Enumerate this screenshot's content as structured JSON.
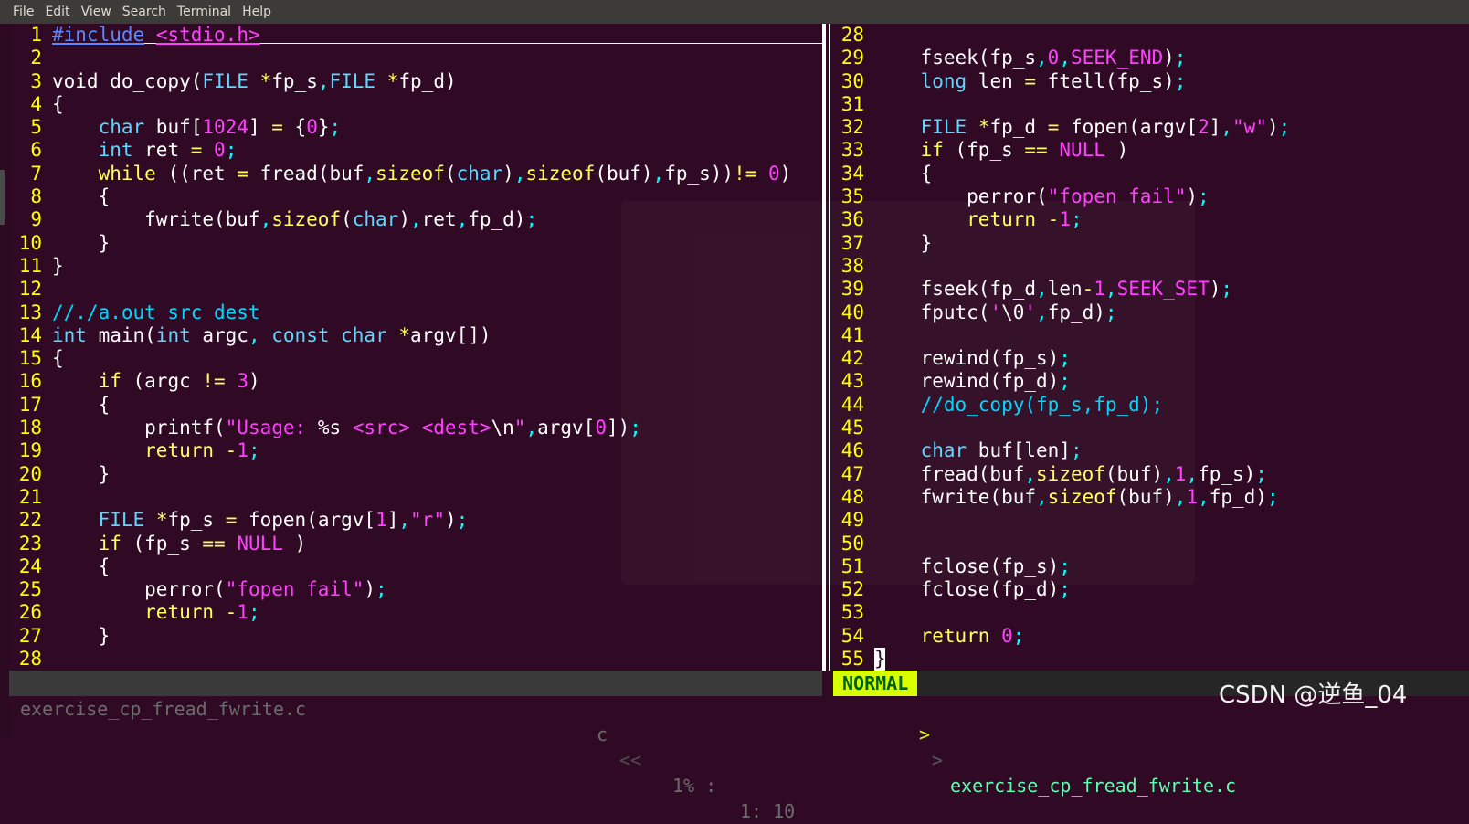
{
  "menubar": {
    "items": [
      "File",
      "Edit",
      "View",
      "Search",
      "Terminal",
      "Help"
    ]
  },
  "left_pane": {
    "lines": [
      {
        "n": "1",
        "html": "<span class=\"t-pp u\">#include</span> <span class=\"t-str u\">&lt;stdio.h&gt;</span>"
      },
      {
        "n": "2",
        "html": ""
      },
      {
        "n": "3",
        "html": "void do_copy(<span class=\"t-type\">FILE</span> <span class=\"t-op\">*</span>fp_s<span class=\"t-punc\">,</span><span class=\"t-type\">FILE</span> <span class=\"t-op\">*</span>fp_d)"
      },
      {
        "n": "4",
        "html": "{"
      },
      {
        "n": "5",
        "html": "    <span class=\"t-type\">char</span> buf[<span class=\"t-num\">1024</span>] <span class=\"t-op\">=</span> {<span class=\"t-num\">0</span>}<span class=\"t-punc\">;</span>"
      },
      {
        "n": "6",
        "html": "    <span class=\"t-type\">int</span> ret <span class=\"t-op\">=</span> <span class=\"t-num\">0</span><span class=\"t-punc\">;</span>"
      },
      {
        "n": "7",
        "html": "    <span class=\"t-kw\">while</span> ((ret <span class=\"t-op\">=</span> fread(buf<span class=\"t-punc\">,</span><span class=\"t-kw\">sizeof</span>(<span class=\"t-type\">char</span>)<span class=\"t-punc\">,</span><span class=\"t-kw\">sizeof</span>(buf)<span class=\"t-punc\">,</span>fp_s))<span class=\"t-op\">!=</span> <span class=\"t-num\">0</span>)"
      },
      {
        "n": "8",
        "html": "    {"
      },
      {
        "n": "9",
        "html": "        fwrite(buf<span class=\"t-punc\">,</span><span class=\"t-kw\">sizeof</span>(<span class=\"t-type\">char</span>)<span class=\"t-punc\">,</span>ret<span class=\"t-punc\">,</span>fp_d)<span class=\"t-punc\">;</span>"
      },
      {
        "n": "10",
        "html": "    }"
      },
      {
        "n": "11",
        "html": "}"
      },
      {
        "n": "12",
        "html": ""
      },
      {
        "n": "13",
        "html": "<span class=\"t-cmt\">//./a.out src dest</span>"
      },
      {
        "n": "14",
        "html": "<span class=\"t-type\">int</span> main(<span class=\"t-type\">int</span> argc<span class=\"t-punc\">,</span> <span class=\"t-type\">const</span> <span class=\"t-type\">char</span> <span class=\"t-op\">*</span>argv[])"
      },
      {
        "n": "15",
        "html": "{"
      },
      {
        "n": "16",
        "html": "    <span class=\"t-kw\">if</span> (argc <span class=\"t-op\">!=</span> <span class=\"t-num\">3</span>)"
      },
      {
        "n": "17",
        "html": "    {"
      },
      {
        "n": "18",
        "html": "        printf(<span class=\"t-str\">\"Usage: </span>%s<span class=\"t-str\"> &lt;src&gt; &lt;dest&gt;</span>\\n<span class=\"t-str\">\"</span><span class=\"t-punc\">,</span>argv[<span class=\"t-num\">0</span>])<span class=\"t-punc\">;</span>"
      },
      {
        "n": "19",
        "html": "        <span class=\"t-kw\">return</span> <span class=\"t-op\">-</span><span class=\"t-num\">1</span><span class=\"t-punc\">;</span>"
      },
      {
        "n": "20",
        "html": "    }"
      },
      {
        "n": "21",
        "html": ""
      },
      {
        "n": "22",
        "html": "    <span class=\"t-type\">FILE</span> <span class=\"t-op\">*</span>fp_s <span class=\"t-op\">=</span> fopen(argv[<span class=\"t-num\">1</span>]<span class=\"t-punc\">,</span><span class=\"t-str\">\"r\"</span>)<span class=\"t-punc\">;</span>"
      },
      {
        "n": "23",
        "html": "    <span class=\"t-kw\">if</span> (fp_s <span class=\"t-op\">==</span> <span class=\"t-spec\">NULL</span> )"
      },
      {
        "n": "24",
        "html": "    {"
      },
      {
        "n": "25",
        "html": "        perror(<span class=\"t-str\">\"fopen fail\"</span>)<span class=\"t-punc\">;</span>"
      },
      {
        "n": "26",
        "html": "        <span class=\"t-kw\">return</span> <span class=\"t-op\">-</span><span class=\"t-num\">1</span><span class=\"t-punc\">;</span>"
      },
      {
        "n": "27",
        "html": "    }"
      },
      {
        "n": "28",
        "html": ""
      }
    ]
  },
  "right_pane": {
    "lines": [
      {
        "n": "28",
        "html": ""
      },
      {
        "n": "29",
        "html": "    fseek(fp_s<span class=\"t-punc\">,</span><span class=\"t-num\">0</span><span class=\"t-punc\">,</span><span class=\"t-spec\">SEEK_END</span>)<span class=\"t-punc\">;</span>"
      },
      {
        "n": "30",
        "html": "    <span class=\"t-type\">long</span> len <span class=\"t-op\">=</span> ftell(fp_s)<span class=\"t-punc\">;</span>"
      },
      {
        "n": "31",
        "html": ""
      },
      {
        "n": "32",
        "html": "    <span class=\"t-type\">FILE</span> <span class=\"t-op\">*</span>fp_d <span class=\"t-op\">=</span> fopen(argv[<span class=\"t-num\">2</span>]<span class=\"t-punc\">,</span><span class=\"t-str\">\"w\"</span>)<span class=\"t-punc\">;</span>"
      },
      {
        "n": "33",
        "html": "    <span class=\"t-kw\">if</span> (fp_s <span class=\"t-op\">==</span> <span class=\"t-spec\">NULL</span> )"
      },
      {
        "n": "34",
        "html": "    {"
      },
      {
        "n": "35",
        "html": "        perror(<span class=\"t-str\">\"fopen fail\"</span>)<span class=\"t-punc\">;</span>"
      },
      {
        "n": "36",
        "html": "        <span class=\"t-kw\">return</span> <span class=\"t-op\">-</span><span class=\"t-num\">1</span><span class=\"t-punc\">;</span>"
      },
      {
        "n": "37",
        "html": "    }"
      },
      {
        "n": "38",
        "html": ""
      },
      {
        "n": "39",
        "html": "    fseek(fp_d<span class=\"t-punc\">,</span>len<span class=\"t-op\">-</span><span class=\"t-num\">1</span><span class=\"t-punc\">,</span><span class=\"t-spec\">SEEK_SET</span>)<span class=\"t-punc\">;</span>"
      },
      {
        "n": "40",
        "html": "    fputc(<span class=\"t-str\">'</span>\\0<span class=\"t-str\">'</span><span class=\"t-punc\">,</span>fp_d)<span class=\"t-punc\">;</span>"
      },
      {
        "n": "41",
        "html": ""
      },
      {
        "n": "42",
        "html": "    rewind(fp_s)<span class=\"t-punc\">;</span>"
      },
      {
        "n": "43",
        "html": "    rewind(fp_d)<span class=\"t-punc\">;</span>"
      },
      {
        "n": "44",
        "html": "    <span class=\"t-cmt\">//do_copy(fp_s,fp_d);</span>"
      },
      {
        "n": "45",
        "html": ""
      },
      {
        "n": "46",
        "html": "    <span class=\"t-type\">char</span> buf[len]<span class=\"t-punc\">;</span>"
      },
      {
        "n": "47",
        "html": "    fread(buf<span class=\"t-punc\">,</span><span class=\"t-kw\">sizeof</span>(buf)<span class=\"t-punc\">,</span><span class=\"t-num\">1</span><span class=\"t-punc\">,</span>fp_s)<span class=\"t-punc\">;</span>"
      },
      {
        "n": "48",
        "html": "    fwrite(buf<span class=\"t-punc\">,</span><span class=\"t-kw\">sizeof</span>(buf)<span class=\"t-punc\">,</span><span class=\"t-num\">1</span><span class=\"t-punc\">,</span>fp_d)<span class=\"t-punc\">;</span>"
      },
      {
        "n": "49",
        "html": ""
      },
      {
        "n": "50",
        "html": ""
      },
      {
        "n": "51",
        "html": "    fclose(fp_s)<span class=\"t-punc\">;</span>"
      },
      {
        "n": "52",
        "html": "    fclose(fp_d)<span class=\"t-punc\">;</span>"
      },
      {
        "n": "53",
        "html": ""
      },
      {
        "n": "54",
        "html": "    <span class=\"t-kw\">return</span> <span class=\"t-num\">0</span><span class=\"t-punc\">;</span>"
      },
      {
        "n": "55",
        "html": "<span class=\"cursor\">}</span>"
      }
    ]
  },
  "status_left": {
    "filename": "exercise_cp_fread_fwrite.c",
    "filetype": "c",
    "separator": "<<",
    "percent": "1% :",
    "position": "1: 10"
  },
  "status_right": {
    "mode": "NORMAL",
    "arrow": ">",
    "arrow2": ">",
    "filename": "exercise_cp_fread_fwrite.c"
  },
  "watermark": "CSDN @逆鱼_04",
  "colors": {
    "background": "#300a24",
    "line_number": "#ffff00",
    "mode_bg": "#d7ff00"
  }
}
